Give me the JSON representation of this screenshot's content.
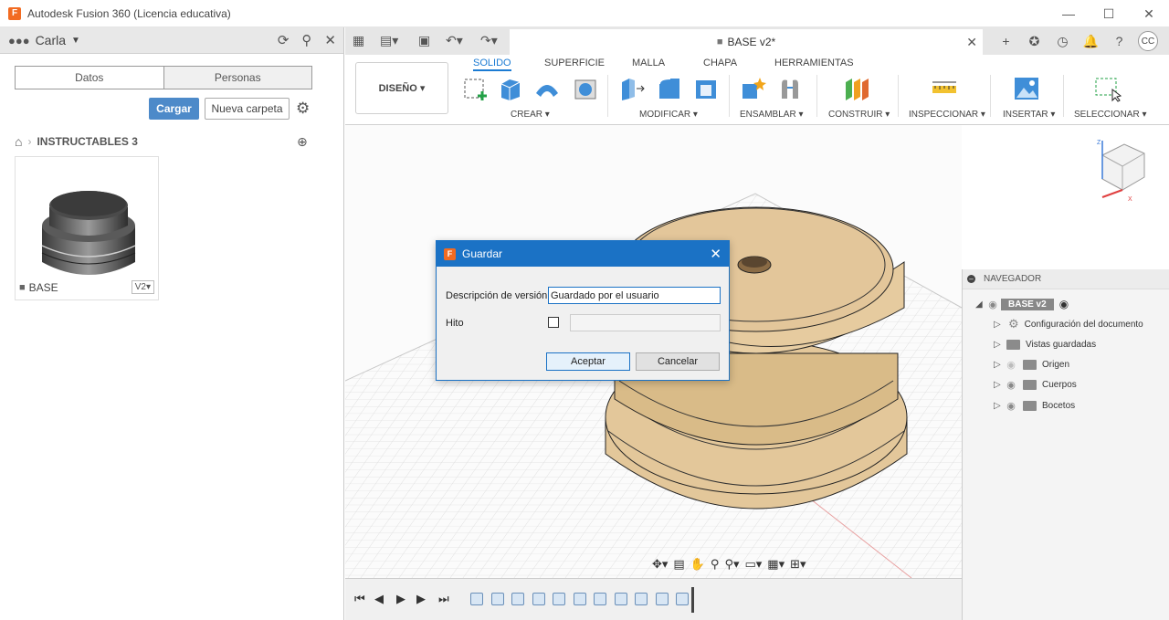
{
  "window": {
    "title": "Autodesk Fusion 360 (Licencia educativa)",
    "app_icon": "F",
    "minimize": "—",
    "maximize": "☐",
    "close": "✕"
  },
  "data_panel": {
    "user": "Carla",
    "tabs": [
      "Datos",
      "Personas"
    ],
    "upload_label": "Cargar",
    "new_folder_label": "Nueva carpeta",
    "project": "INSTRUCTABLES 3",
    "item": {
      "name": "BASE",
      "version": "V2▾"
    }
  },
  "document_tab": {
    "name": "BASE v2*",
    "close": "✕"
  },
  "user_initials": "CC",
  "ribbon": {
    "workspace": "DISEÑO ▾",
    "tabs": [
      "SOLIDO",
      "SUPERFICIE",
      "MALLA",
      "CHAPA",
      "HERRAMIENTAS"
    ],
    "active_tab": "SOLIDO",
    "groups": [
      "CREAR ▾",
      "MODIFICAR ▾",
      "ENSAMBLAR ▾",
      "CONSTRUIR ▾",
      "INSPECCIONAR ▾",
      "INSERTAR ▾",
      "SELECCIONAR ▾"
    ]
  },
  "navigator": {
    "title": "NAVEGADOR",
    "root": "BASE v2",
    "items": [
      "Configuración del documento",
      "Vistas guardadas",
      "Origen",
      "Cuerpos",
      "Bocetos"
    ]
  },
  "dialog": {
    "title": "Guardar",
    "icon": "F",
    "close": "✕",
    "version_label": "Descripción de versión",
    "version_value": "Guardado por el usuario",
    "milestone_label": "Hito",
    "ok_label": "Aceptar",
    "cancel_label": "Cancelar"
  },
  "colors": {
    "accent": "#1b72c5",
    "ribbon_active": "#1b7bd3",
    "upload_button": "#4d8ac9",
    "model_tan": "#e3c79a",
    "brand_orange": "#f26b22"
  }
}
